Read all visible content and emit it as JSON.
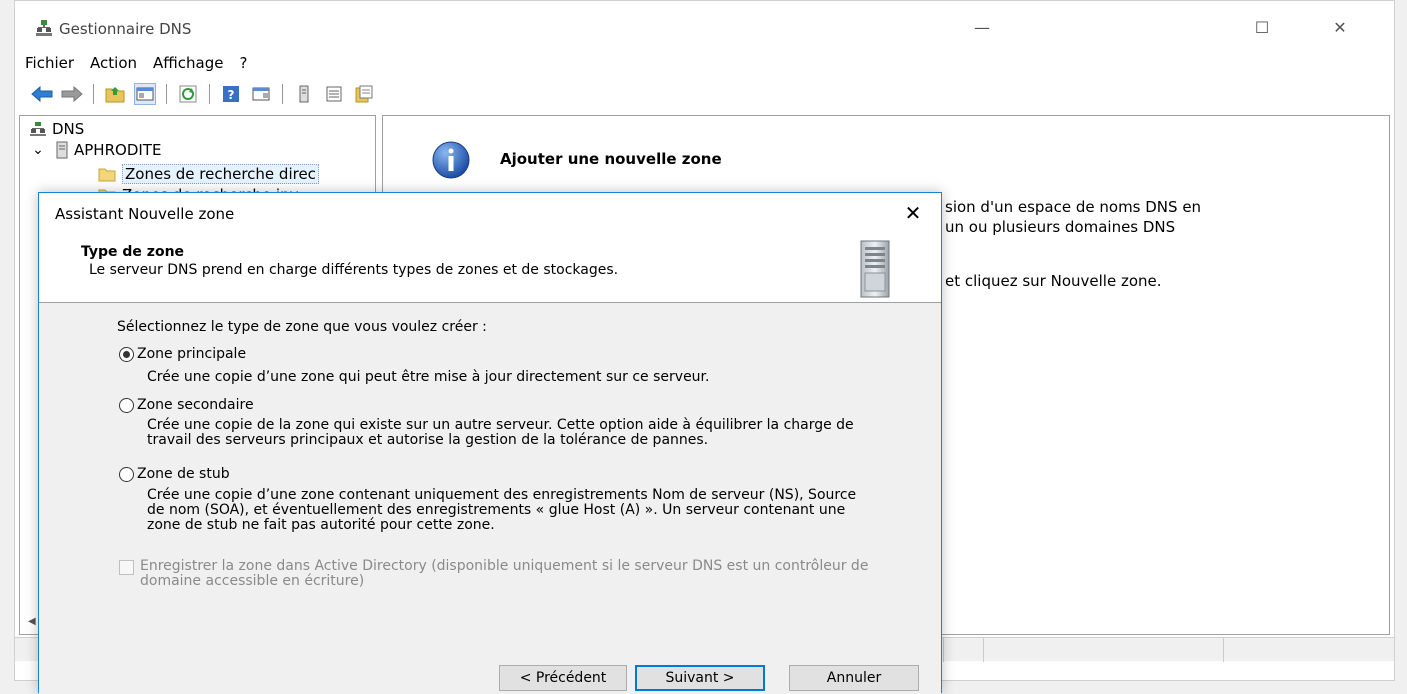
{
  "window": {
    "title": "Gestionnaire DNS",
    "controls": {
      "minimize": "—",
      "maximize": "☐",
      "close": "✕"
    }
  },
  "menu": [
    "Fichier",
    "Action",
    "Affichage",
    "?"
  ],
  "toolbar_icons": [
    "back-arrow-icon",
    "forward-arrow-icon",
    "folder-up-icon",
    "console-tree-icon",
    "refresh-icon",
    "help-icon",
    "action-pane-icon",
    "server-icon",
    "list-icon",
    "export-icon"
  ],
  "tree": {
    "root": "DNS",
    "server": "APHRODITE",
    "server_chevron": "⌄",
    "selected": "Zones de recherche direc",
    "next_partial": "Zones de recherche inv"
  },
  "content": {
    "title": "Ajouter une nouvelle zone",
    "line1": "sion d'un espace de noms DNS en",
    "line2": "un ou plusieurs domaines DNS",
    "line3": "et cliquez sur Nouvelle zone."
  },
  "wizard": {
    "title": "Assistant Nouvelle zone",
    "close": "✕",
    "header_title": "Type de zone",
    "header_subtitle": "Le serveur DNS prend en charge différents types de zones et de stockages.",
    "prompt": "Sélectionnez le type de zone que vous voulez créer :",
    "options": [
      {
        "label": "Zone principale",
        "selected": true,
        "description": "Crée une copie d’une zone qui peut être mise à jour directement sur ce serveur."
      },
      {
        "label": "Zone secondaire",
        "selected": false,
        "description": "Crée une copie de la zone qui existe sur un autre serveur. Cette option aide à équilibrer la charge de travail des serveurs principaux et autorise la gestion de la tolérance de pannes."
      },
      {
        "label": "Zone de stub",
        "selected": false,
        "description": "Crée une copie d’une zone contenant uniquement des enregistrements Nom de serveur (NS), Source de nom (SOA), et éventuellement des enregistrements « glue Host (A) ». Un serveur contenant une zone de stub ne fait pas autorité pour cette zone."
      }
    ],
    "checkbox_label": "Enregistrer la zone dans Active Directory (disponible uniquement si le serveur DNS est un contrôleur de domaine accessible en écriture)",
    "checkbox_checked": false,
    "checkbox_disabled": true,
    "buttons": {
      "previous": "< Précédent",
      "next": "Suivant >",
      "cancel": "Annuler"
    }
  },
  "colors": {
    "accent": "#0078d7",
    "dialog_border": "#1883d7",
    "selection": "#e5f3ff"
  }
}
